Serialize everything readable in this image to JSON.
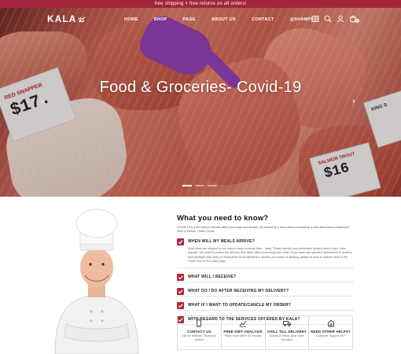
{
  "topbar": {
    "text": "free shipping + free returns on all orders!"
  },
  "brand": {
    "logo": "KALA",
    "logo_arabic": "كلا"
  },
  "nav": {
    "items": [
      "HOME",
      "SHOP",
      "PAGE",
      "ABOUT US",
      "CONTACT",
      "@SHAMPOO"
    ],
    "icons": [
      "catalog-icon",
      "search-icon",
      "user-icon",
      "cart-icon"
    ],
    "cart_count": "0"
  },
  "hero": {
    "title": "Food & Groceries- Covid-19",
    "arrow_left": "‹",
    "arrow_right": "›",
    "sign_red_name": "RED SNAPPER",
    "sign_red_price": "$17.",
    "sign_salmon_name": "SALMON TROUT",
    "sign_salmon_price": "$16",
    "sign_white_name": "KING S"
  },
  "info": {
    "heading": "What you need to know?",
    "intro": "COVID-19 is a new illness that can affect your lungs and airways. It's caused by a virus called coronavirus. It was discovered in December 2019 in Wuhan, Hubei, China.",
    "items": [
      {
        "title": "WHEN WILL MY MEALS ARRIVE?",
        "body": "Meal plans are shipped to you daily in early morning (5am - 9am). Please specify your preferable delivery time in your order request. We shall re-confirm the delivery time again after processing your order. If you have any special requirements in delivery time (multiple time slots) or instructions for Email/Meal to access your place of delivery, please be sure to include them in the \"Note\" box on the order page."
      },
      {
        "title": "WHAT WILL I RECEIVE?"
      },
      {
        "title": "WHAT DO I DO AFTER RECEIVING MY DELIVERY?"
      },
      {
        "title": "WHAT IF I WANT TO UPDATE/CANCLE MY ORDER?"
      },
      {
        "title": "WITH REGARD TO THE SERVICES OFFERED BY KALA?"
      }
    ]
  },
  "features": [
    {
      "icon": "phone-icon",
      "title": "CONTACT US",
      "text": "Via our Website, Facebook, Hotline"
    },
    {
      "icon": "analysis-icon",
      "title": "FREE DIET ANALYSIS",
      "text": "Place order within 02 minutes"
    },
    {
      "icon": "truck-icon",
      "title": "CHILL TILL DELIVERY",
      "text": "House or Office, your name the place"
    },
    {
      "icon": "help-icon",
      "title": "NEED OTHER HELPS?",
      "text": "Customer Support 24/7"
    }
  ],
  "colors": {
    "accent": "#a3253b",
    "checkbox": "#b3283e"
  }
}
